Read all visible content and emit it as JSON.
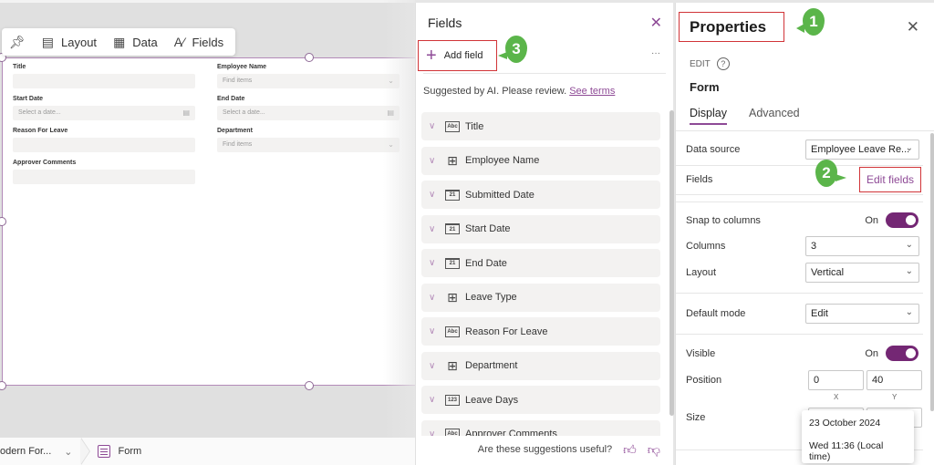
{
  "colors": {
    "accent": "#8e4a96",
    "toggle_on": "#742774",
    "highlight_box": "#d13438",
    "callout": "#5bb54a"
  },
  "canvas": {
    "toolbar": {
      "pin_icon": "pin-icon",
      "layout_label": "Layout",
      "data_label": "Data",
      "fields_label": "Fields"
    },
    "form": {
      "fields": [
        {
          "label": "Title",
          "placeholder": "",
          "type": "text"
        },
        {
          "label": "Employee Name",
          "placeholder": "Find items",
          "type": "lookup"
        },
        {
          "label": "Start Date",
          "placeholder": "Select a date...",
          "type": "date"
        },
        {
          "label": "End Date",
          "placeholder": "Select a date...",
          "type": "date"
        },
        {
          "label": "Reason For Leave",
          "placeholder": "",
          "type": "text"
        },
        {
          "label": "Department",
          "placeholder": "Find items",
          "type": "lookup"
        },
        {
          "label": "Approver Comments",
          "placeholder": "",
          "type": "text"
        }
      ]
    },
    "breadcrumb": {
      "screen_label": "odern For...",
      "control_label": "Form"
    }
  },
  "fields_panel": {
    "title": "Fields",
    "add_field_label": "Add field",
    "more_label": "···",
    "suggested_text": "Suggested by AI. Please review.",
    "see_terms_label": "See terms",
    "items": [
      {
        "label": "Title",
        "icon": "Abc",
        "type": "text"
      },
      {
        "label": "Employee Name",
        "icon": "lookup",
        "type": "lookup"
      },
      {
        "label": "Submitted Date",
        "icon": "21",
        "type": "date"
      },
      {
        "label": "Start Date",
        "icon": "21",
        "type": "date"
      },
      {
        "label": "End Date",
        "icon": "21",
        "type": "date"
      },
      {
        "label": "Leave Type",
        "icon": "lookup",
        "type": "lookup"
      },
      {
        "label": "Reason For Leave",
        "icon": "Abc",
        "type": "text"
      },
      {
        "label": "Department",
        "icon": "lookup",
        "type": "lookup"
      },
      {
        "label": "Leave Days",
        "icon": "123",
        "type": "number"
      },
      {
        "label": "Approver Comments",
        "icon": "Abc",
        "type": "text"
      }
    ],
    "footer_question": "Are these suggestions useful?"
  },
  "properties_panel": {
    "title": "Properties",
    "edit_label": "EDIT",
    "control_name": "Form",
    "tabs": [
      {
        "label": "Display",
        "active": true
      },
      {
        "label": "Advanced",
        "active": false
      }
    ],
    "data_source_label": "Data source",
    "data_source_value": "Employee Leave Re...",
    "fields_label": "Fields",
    "edit_fields_label": "Edit fields",
    "snap_label": "Snap to columns",
    "snap_state": "On",
    "columns_label": "Columns",
    "columns_value": "3",
    "layout_label": "Layout",
    "layout_value": "Vertical",
    "default_mode_label": "Default mode",
    "default_mode_value": "Edit",
    "visible_label": "Visible",
    "visible_state": "On",
    "position_label": "Position",
    "position_x": "0",
    "position_y": "40",
    "x_label": "X",
    "y_label": "Y",
    "size_label": "Size"
  },
  "tooltip": {
    "date": "23 October 2024",
    "time": "Wed 11:36 (Local time)"
  },
  "callouts": {
    "one": "1",
    "two": "2",
    "three": "3"
  }
}
